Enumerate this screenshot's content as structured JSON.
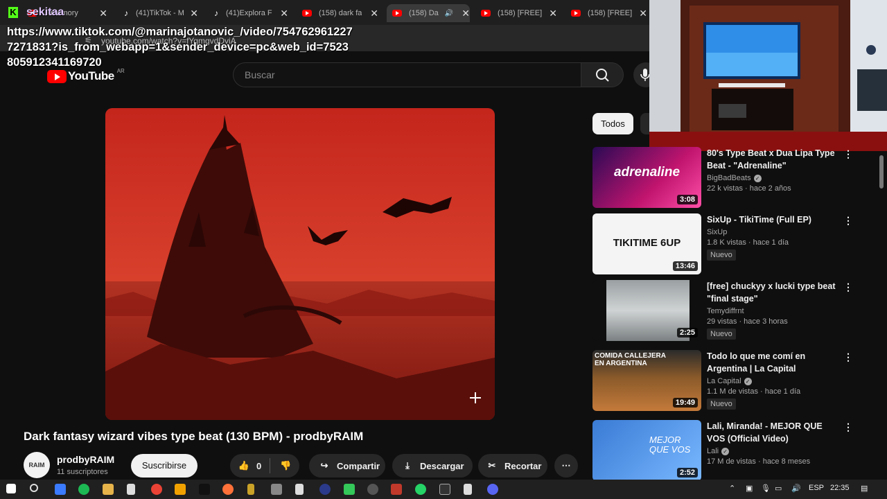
{
  "overlay": {
    "streamer": "sekitaa",
    "url_text": "https://www.tiktok.com/@marinajotanovic_/video/7547629612277271831?is_from_webapp=1&sender_device=pc&web_id=7523805912341169720"
  },
  "tabs": [
    {
      "icon": "youtube-icon",
      "title": "...memory"
    },
    {
      "icon": "tiktok-icon",
      "title": "(41)TikTok - M"
    },
    {
      "icon": "tiktok-icon",
      "title": "(41)Explora F"
    },
    {
      "icon": "youtube-icon",
      "title": "(158) dark fa"
    },
    {
      "icon": "youtube-icon",
      "title": "(158) Da"
    },
    {
      "icon": "youtube-icon",
      "title": "(158) [FREE]"
    },
    {
      "icon": "youtube-icon",
      "title": "(158) [FREE]"
    }
  ],
  "address_bar": {
    "url": "youtube.com/watch?v=fYqmgvdDviA"
  },
  "header": {
    "logo_text": "YouTube",
    "country_code": "AR",
    "search_placeholder": "Buscar"
  },
  "video": {
    "title": "Dark fantasy wizard vibes type beat (130 BPM) - prodbyRAIM",
    "channel": "prodbyRAIM",
    "avatar_text": "RAIM",
    "subscribers": "11 suscriptores",
    "subscribe_label": "Suscribirse",
    "likes": "0",
    "share_label": "Compartir",
    "download_label": "Descargar",
    "clip_label": "Recortar"
  },
  "chips": {
    "all": "Todos"
  },
  "recommendations": [
    {
      "title": "80's Type Beat x Dua Lipa Type Beat - \"Adrenaline\"",
      "thumb_text": "adrenaline",
      "channel": "BigBadBeats",
      "verified": true,
      "meta": "22 k vistas · hace 2 años",
      "duration": "3:08",
      "badge": ""
    },
    {
      "title": "SixUp - TikiTime (Full EP)",
      "thumb_text": "TIKITIME 6UP",
      "channel": "SixUp",
      "verified": false,
      "meta": "1.8 K vistas · hace 1 día",
      "duration": "13:46",
      "badge": "Nuevo"
    },
    {
      "title": "[free] chuckyy x lucki type beat \"final stage\"",
      "thumb_text": "",
      "channel": "Temydiffrnt",
      "verified": false,
      "meta": "29 vistas · hace 3 horas",
      "duration": "2:25",
      "badge": "Nuevo"
    },
    {
      "title": "Todo lo que me comí en Argentina | La Capital",
      "thumb_text": "COMIDA CALLEJERA EN ARGENTINA",
      "channel": "La Capital",
      "verified": true,
      "meta": "1.1 M de vistas · hace 1 día",
      "duration": "19:49",
      "badge": "Nuevo"
    },
    {
      "title": "Lali, Miranda! - MEJOR QUE VOS (Official Video)",
      "thumb_text": "MEJOR QUE VOS",
      "channel": "Lali",
      "verified": true,
      "meta": "17 M de vistas · hace 8 meses",
      "duration": "2:52",
      "badge": ""
    }
  ],
  "taskbar": {
    "lang": "ESP",
    "time": "22:35"
  },
  "colors": {
    "bg": "#0f0f0f",
    "accent": "#ff0000",
    "kick": "#53fc18"
  }
}
